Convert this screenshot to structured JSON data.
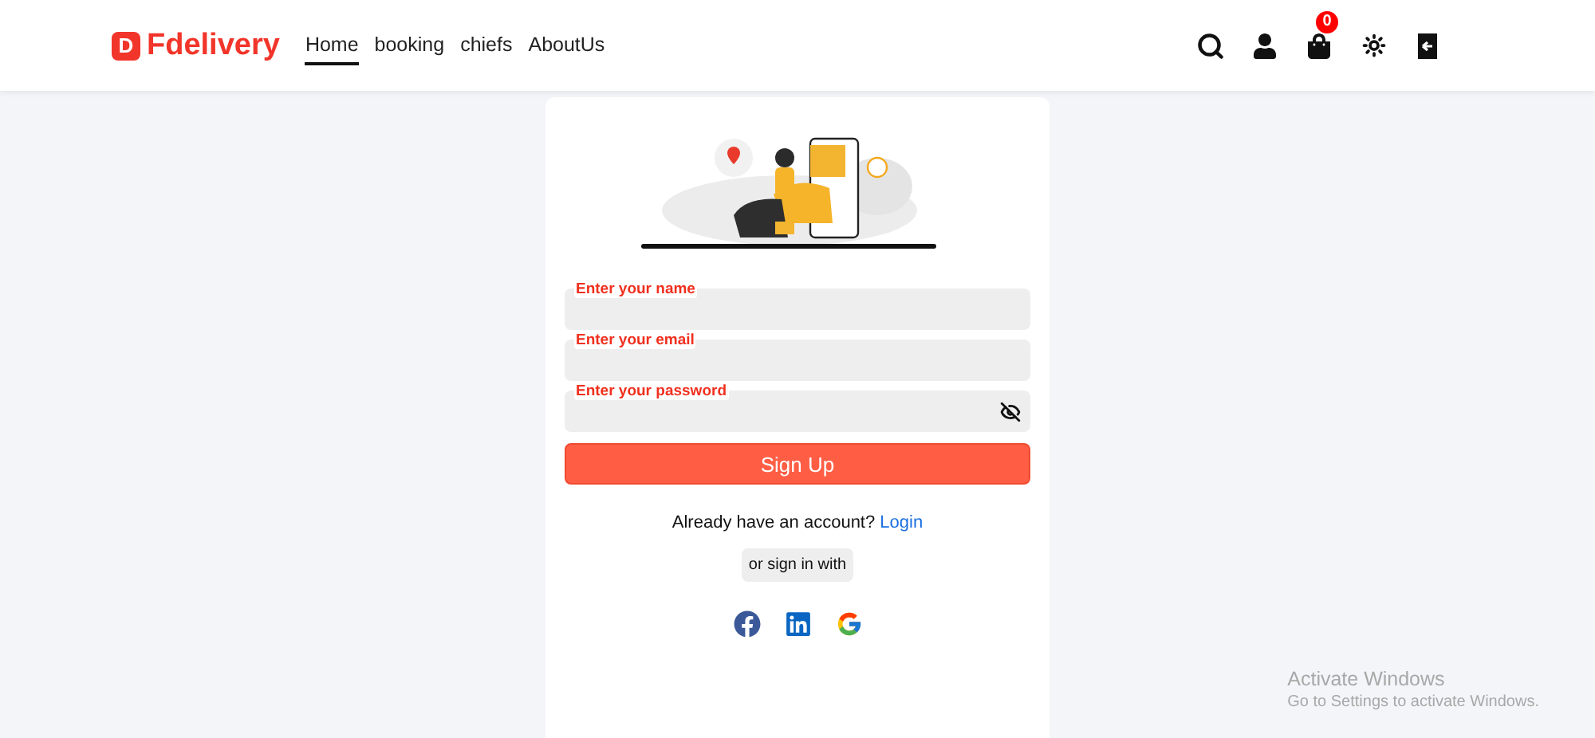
{
  "header": {
    "logo": {
      "mark": "D",
      "name": "Fdelivery"
    },
    "nav": [
      {
        "label": "Home",
        "selected": true
      },
      {
        "label": "booking",
        "selected": false
      },
      {
        "label": "chiefs",
        "selected": false
      },
      {
        "label": "AboutUs",
        "selected": false
      }
    ],
    "actions": [
      {
        "kind": "search"
      },
      {
        "kind": "user"
      },
      {
        "kind": "cart",
        "badge": "0"
      },
      {
        "kind": "theme"
      },
      {
        "kind": "logout"
      }
    ]
  },
  "signup": {
    "fields": [
      {
        "label": "Enter your name",
        "kind": "text"
      },
      {
        "label": "Enter your email",
        "kind": "email"
      },
      {
        "label": "Enter your password",
        "kind": "password"
      }
    ],
    "submit": "Sign Up",
    "login_prompt": {
      "text": "Already have an account?",
      "link": "Login"
    },
    "divider": "or sign in with",
    "social": [
      {
        "kind": "facebook"
      },
      {
        "kind": "linkedin"
      },
      {
        "kind": "google"
      }
    ]
  },
  "os_overlay": {
    "title": "Activate Windows",
    "subtitle": "Go to Settings to activate Windows."
  }
}
